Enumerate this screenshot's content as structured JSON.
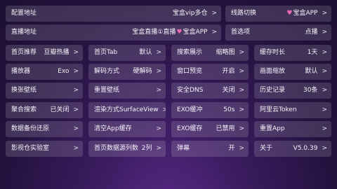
{
  "rows": [
    [
      {
        "label": "配置地址",
        "value": "宝盒vip多仓",
        "arrow": ">"
      },
      {
        "label": "线路切换",
        "value": "宝盒APP",
        "heart": true,
        "arrow": ">"
      }
    ],
    [
      {
        "label": "直播地址",
        "value_a": "宝盒直播①直播",
        "value_b": "宝盒APP",
        "arrow": ">"
      },
      {
        "label": "首选项",
        "value": "点播",
        "arrow": ">"
      }
    ],
    [
      {
        "label": "首页推荐",
        "value": "豆瓣热播",
        "arrow": ">"
      },
      {
        "label": "首页Tab",
        "value": "默认",
        "arrow": ">"
      },
      {
        "label": "搜索展示",
        "value": "缩略图",
        "arrow": ">"
      },
      {
        "label": "缓存时长",
        "value": "1天",
        "arrow": ">"
      }
    ],
    [
      {
        "label": "播放器",
        "value": "Exo",
        "arrow": ">"
      },
      {
        "label": "解码方式",
        "value": "硬解码",
        "arrow": ">"
      },
      {
        "label": "窗口预览",
        "value": "开启",
        "arrow": ">"
      },
      {
        "label": "画面缩放",
        "value": "默认",
        "arrow": ">"
      }
    ],
    [
      {
        "label": "换张壁纸",
        "value": "",
        "arrow": ">"
      },
      {
        "label": "重置壁纸",
        "value": "",
        "arrow": ">"
      },
      {
        "label": "安全DNS",
        "value": "关闭",
        "arrow": ">"
      },
      {
        "label": "历史记录",
        "value": "30条",
        "arrow": ">"
      }
    ],
    [
      {
        "label": "聚合搜索",
        "value": "已关闭",
        "arrow": ">"
      },
      {
        "label": "渲染方式",
        "value": "SurfaceView",
        "arrow": ">"
      },
      {
        "label": "EXO缓冲",
        "value": "50s",
        "arrow": ">"
      },
      {
        "label": "阿里云Token",
        "value": "",
        "arrow": ">"
      }
    ],
    [
      {
        "label": "数据备份还原",
        "value": "",
        "arrow": ">"
      },
      {
        "label": "清空App缓存",
        "value": "",
        "arrow": ">"
      },
      {
        "label": "EXO缓存",
        "value": "已禁用",
        "arrow": ">"
      },
      {
        "label": "重置App",
        "value": "",
        "arrow": ">"
      }
    ],
    [
      {
        "label": "影视仓实验室",
        "value": "",
        "arrow": ">"
      },
      {
        "label": "首页数据源列数",
        "value": "2列",
        "arrow": ">"
      },
      {
        "label": "弹幕",
        "value": "开",
        "arrow": ">"
      },
      {
        "label": "关于",
        "value": "V5.0.39",
        "arrow": ">"
      }
    ]
  ]
}
